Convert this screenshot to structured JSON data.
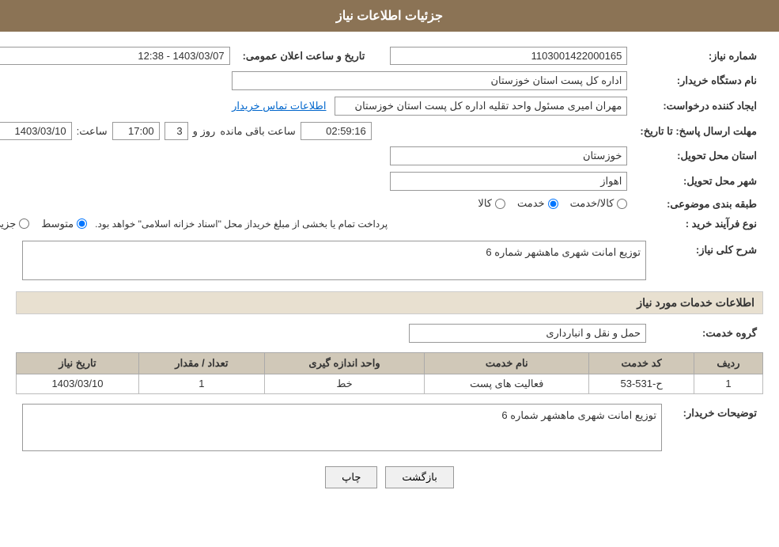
{
  "page": {
    "title": "جزئیات اطلاعات نیاز"
  },
  "header": {
    "title": "جزئیات اطلاعات نیاز"
  },
  "fields": {
    "need_number_label": "شماره نیاز:",
    "need_number_value": "1103001422000165",
    "announcement_date_label": "تاریخ و ساعت اعلان عمومی:",
    "announcement_date_value": "1403/03/07 - 12:38",
    "buyer_org_label": "نام دستگاه خریدار:",
    "buyer_org_value": "اداره کل پست استان خوزستان",
    "creator_label": "ایجاد کننده درخواست:",
    "creator_value": "مهران امیری مسئول واحد تقلیه اداره کل پست استان خوزستان",
    "contact_link": "اطلاعات تماس خریدار",
    "deadline_label": "مهلت ارسال پاسخ: تا تاریخ:",
    "deadline_date": "1403/03/10",
    "deadline_time_label": "ساعت:",
    "deadline_time": "17:00",
    "deadline_days_label": "روز و",
    "deadline_days": "3",
    "deadline_remaining_label": "ساعت باقی مانده",
    "deadline_remaining": "02:59:16",
    "province_label": "استان محل تحویل:",
    "province_value": "خوزستان",
    "city_label": "شهر محل تحویل:",
    "city_value": "اهواز",
    "category_label": "طبقه بندی موضوعی:",
    "category_options": [
      "کالا",
      "خدمت",
      "کالا/خدمت"
    ],
    "category_selected": "خدمت",
    "purchase_type_label": "نوع فرآیند خرید :",
    "purchase_type_options": [
      "جزیی",
      "متوسط"
    ],
    "purchase_type_selected": "متوسط",
    "purchase_note": "پرداخت تمام یا بخشی از مبلغ خریداز محل \"اسناد خزانه اسلامی\" خواهد بود.",
    "general_desc_label": "شرح کلی نیاز:",
    "general_desc_value": "توزیع امانت شهری ماهشهر شماره 6",
    "services_section_title": "اطلاعات خدمات مورد نیاز",
    "service_group_label": "گروه خدمت:",
    "service_group_value": "حمل و نقل و انبارداری",
    "table": {
      "headers": [
        "ردیف",
        "کد خدمت",
        "نام خدمت",
        "واحد اندازه گیری",
        "تعداد / مقدار",
        "تاریخ نیاز"
      ],
      "rows": [
        {
          "row": "1",
          "code": "ح-531-53",
          "name": "فعالیت های پست",
          "unit": "خط",
          "quantity": "1",
          "date": "1403/03/10"
        }
      ]
    },
    "buyer_comments_label": "توضیحات خریدار:",
    "buyer_comments_value": "توزیع امانت شهری ماهشهر شماره 6"
  },
  "buttons": {
    "back_label": "بازگشت",
    "print_label": "چاپ"
  }
}
